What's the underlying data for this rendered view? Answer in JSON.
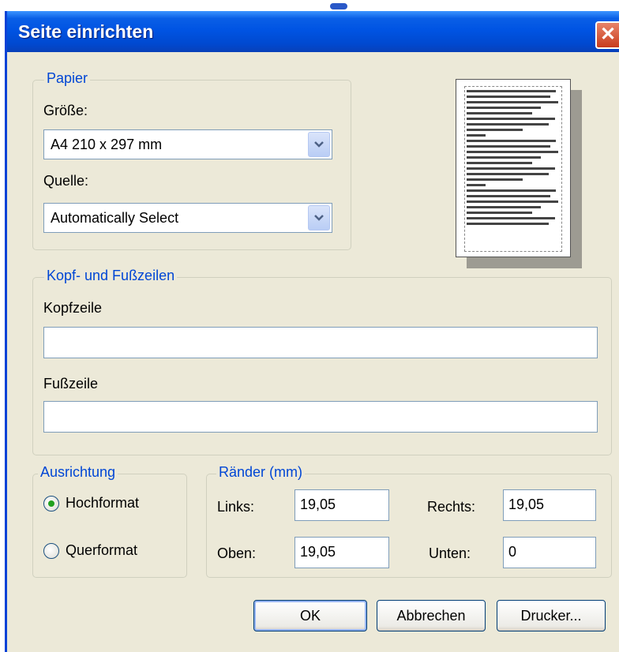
{
  "dialog": {
    "title": "Seite einrichten",
    "close_glyph": "✕"
  },
  "paper": {
    "legend": "Papier",
    "size_label": "Größe:",
    "size_value": "A4 210 x 297 mm",
    "source_label": "Quelle:",
    "source_value": "Automatically Select"
  },
  "header_footer": {
    "legend": "Kopf- und Fußzeilen",
    "header_label": "Kopfzeile",
    "header_value": "",
    "footer_label": "Fußzeile",
    "footer_value": ""
  },
  "orientation": {
    "legend": "Ausrichtung",
    "portrait_label": "Hochformat",
    "landscape_label": "Querformat",
    "selected": "Hochformat"
  },
  "margins": {
    "legend": "Ränder (mm)",
    "left_label": "Links:",
    "left_value": "19,05",
    "right_label": "Rechts:",
    "right_value": "19,05",
    "top_label": "Oben:",
    "top_value": "19,05",
    "bottom_label": "Unten:",
    "bottom_value": "0"
  },
  "buttons": {
    "ok": "OK",
    "cancel": "Abbrechen",
    "printer": "Drucker..."
  },
  "colors": {
    "title_bar": "#0054e3",
    "dialog_bg": "#ece9d8",
    "legend_text": "#0046d5",
    "radio_selected": "#21a121"
  },
  "icons": {
    "dropdown": "chevron-down-icon",
    "close": "close-icon",
    "preview": "page-preview-icon"
  }
}
